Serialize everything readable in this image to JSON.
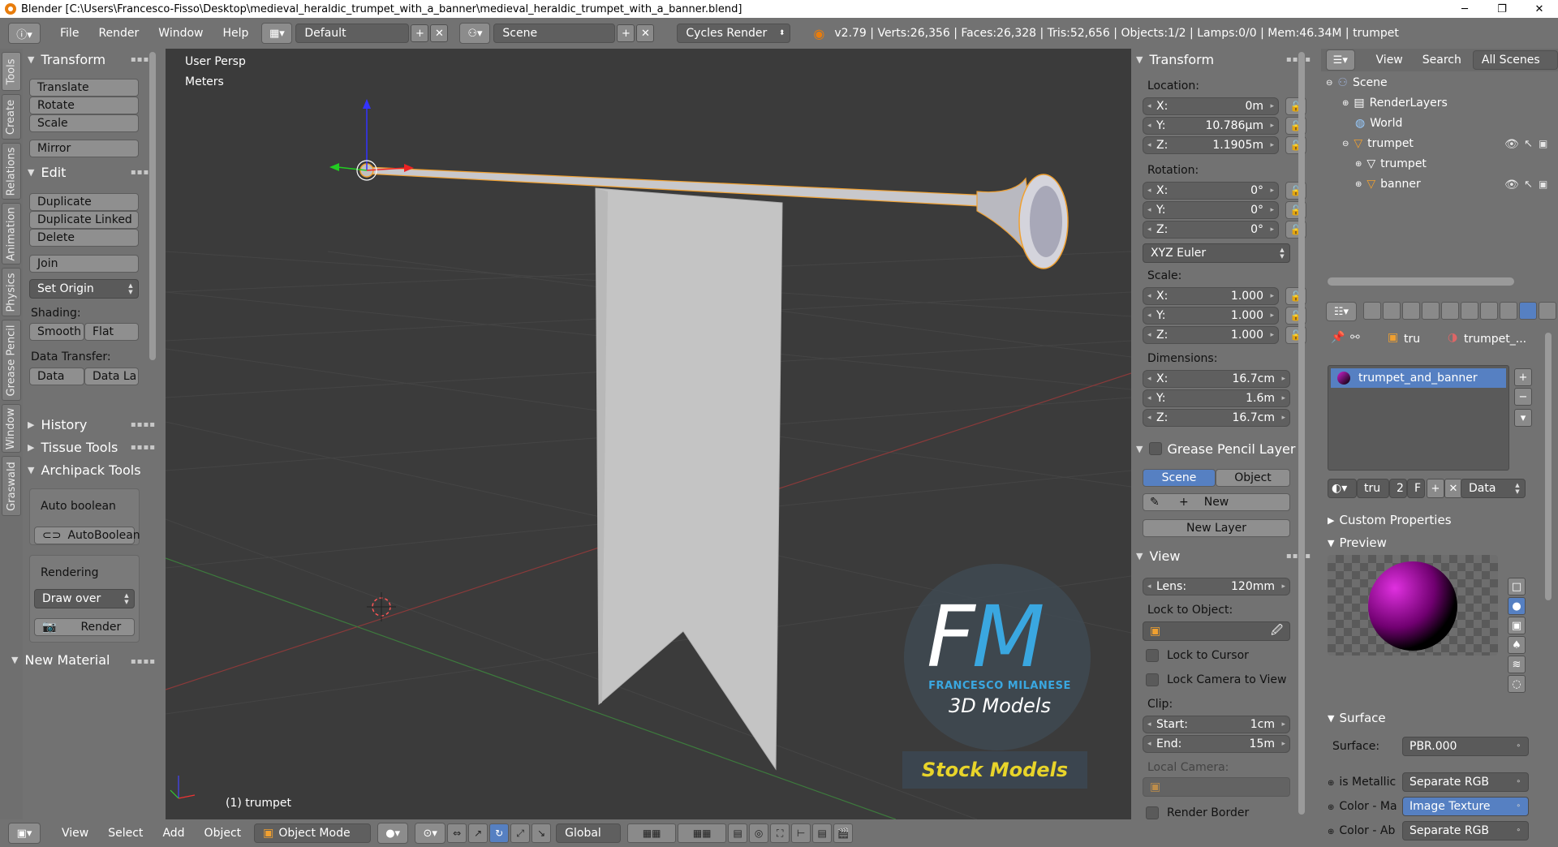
{
  "window": {
    "title": "Blender [C:\\Users\\Francesco-Fisso\\Desktop\\medieval_heraldic_trumpet_with_a_banner\\medieval_heraldic_trumpet_with_a_banner.blend]",
    "minimize": "─",
    "maximize": "❐",
    "close": "✕"
  },
  "infobar": {
    "menus": [
      "File",
      "Render",
      "Window",
      "Help"
    ],
    "layout": "Default",
    "scene": "Scene",
    "engine": "Cycles Render",
    "stats": "v2.79 | Verts:26,356 | Faces:26,328 | Tris:52,656 | Objects:1/2 | Lamps:0/0 | Mem:46.34M | trumpet",
    "add_glyph": "+",
    "close_glyph": "✕"
  },
  "tabs": [
    "Tools",
    "Create",
    "Relations",
    "Animation",
    "Physics",
    "Grease Pencil",
    "Window",
    "Graswald"
  ],
  "tools": {
    "transform_header": "Transform",
    "translate": "Translate",
    "rotate": "Rotate",
    "scale": "Scale",
    "mirror": "Mirror",
    "edit_header": "Edit",
    "duplicate": "Duplicate",
    "duplicate_linked": "Duplicate Linked",
    "delete": "Delete",
    "join": "Join",
    "set_origin": "Set Origin",
    "shading_label": "Shading:",
    "smooth": "Smooth",
    "flat": "Flat",
    "data_transfer_label": "Data Transfer:",
    "data": "Data",
    "data_layers": "Data La",
    "history_header": "History",
    "tissue_header": "Tissue Tools",
    "archipack_header": "Archipack Tools",
    "auto_boolean_label": "Auto boolean",
    "auto_boolean_btn": "AutoBoolean",
    "rendering_label": "Rendering",
    "draw_over": "Draw over",
    "render_btn": "Render",
    "new_material_header": "New Material"
  },
  "viewport": {
    "view_name": "User Persp",
    "units": "Meters",
    "object_label": "(1) trumpet",
    "watermark_letters": "FM",
    "watermark_name": "FRANCESCO MILANESE",
    "watermark_sub": "3D Models",
    "watermark_badge": "Stock Models"
  },
  "npanel": {
    "transform_header": "Transform",
    "location_label": "Location:",
    "loc": [
      {
        "axis": "X:",
        "value": "0m"
      },
      {
        "axis": "Y:",
        "value": "10.786µm"
      },
      {
        "axis": "Z:",
        "value": "1.1905m"
      }
    ],
    "rotation_label": "Rotation:",
    "rot": [
      {
        "axis": "X:",
        "value": "0°"
      },
      {
        "axis": "Y:",
        "value": "0°"
      },
      {
        "axis": "Z:",
        "value": "0°"
      }
    ],
    "rotation_mode": "XYZ Euler",
    "scale_label": "Scale:",
    "scale": [
      {
        "axis": "X:",
        "value": "1.000"
      },
      {
        "axis": "Y:",
        "value": "1.000"
      },
      {
        "axis": "Z:",
        "value": "1.000"
      }
    ],
    "dimensions_label": "Dimensions:",
    "dims": [
      {
        "axis": "X:",
        "value": "16.7cm"
      },
      {
        "axis": "Y:",
        "value": "1.6m"
      },
      {
        "axis": "Z:",
        "value": "16.7cm"
      }
    ],
    "grease_header": "Grease Pencil Layer",
    "gp_scene": "Scene",
    "gp_object": "Object",
    "gp_new": "New",
    "gp_new_layer": "New Layer",
    "view_header": "View",
    "lens_label": "Lens:",
    "lens_value": "120mm",
    "lock_object_label": "Lock to Object:",
    "lock_cursor": "Lock to Cursor",
    "lock_camera": "Lock Camera to View",
    "clip_label": "Clip:",
    "clip_start_label": "Start:",
    "clip_start_value": "1cm",
    "clip_end_label": "End:",
    "clip_end_value": "15m",
    "local_camera_label": "Local Camera:",
    "render_border": "Render Border"
  },
  "outliner": {
    "view_menu": "View",
    "search_menu": "Search",
    "scenes_dropdown": "All Scenes",
    "items": [
      {
        "label": "Scene",
        "indent": 0,
        "icon": "scene-icon"
      },
      {
        "label": "RenderLayers",
        "indent": 1,
        "icon": "render-layers-icon"
      },
      {
        "label": "World",
        "indent": 1,
        "icon": "world-icon"
      },
      {
        "label": "trumpet",
        "indent": 1,
        "icon": "object-icon"
      },
      {
        "label": "trumpet",
        "indent": 2,
        "icon": "mesh-icon"
      },
      {
        "label": "banner",
        "indent": 2,
        "icon": "object-icon"
      }
    ]
  },
  "props": {
    "breadcrumb_object": "tru",
    "breadcrumb_material": "trumpet_...",
    "material_slot": "trumpet_and_banner",
    "mat_name": "tru",
    "mat_users": "2",
    "mat_fake": "F",
    "link_dropdown": "Data",
    "custom_props": "Custom Properties",
    "preview": "Preview",
    "surface_header": "Surface",
    "surface_label": "Surface:",
    "surface_value": "PBR.000",
    "rows": [
      {
        "label": "is Metallic",
        "value": "Separate RGB"
      },
      {
        "label": "Color - Ma",
        "value": "Image Texture"
      },
      {
        "label": "Color - Ab",
        "value": "Separate RGB"
      }
    ]
  },
  "bottombar": {
    "view": "View",
    "select": "Select",
    "add": "Add",
    "object": "Object",
    "mode": "Object Mode",
    "orientation": "Global"
  },
  "colors": {
    "accent_blue": "#5680c2",
    "selected_orange": "#f0a030",
    "watermark_blue": "#3aa7e0",
    "badge_yellow": "#e8d42a"
  }
}
